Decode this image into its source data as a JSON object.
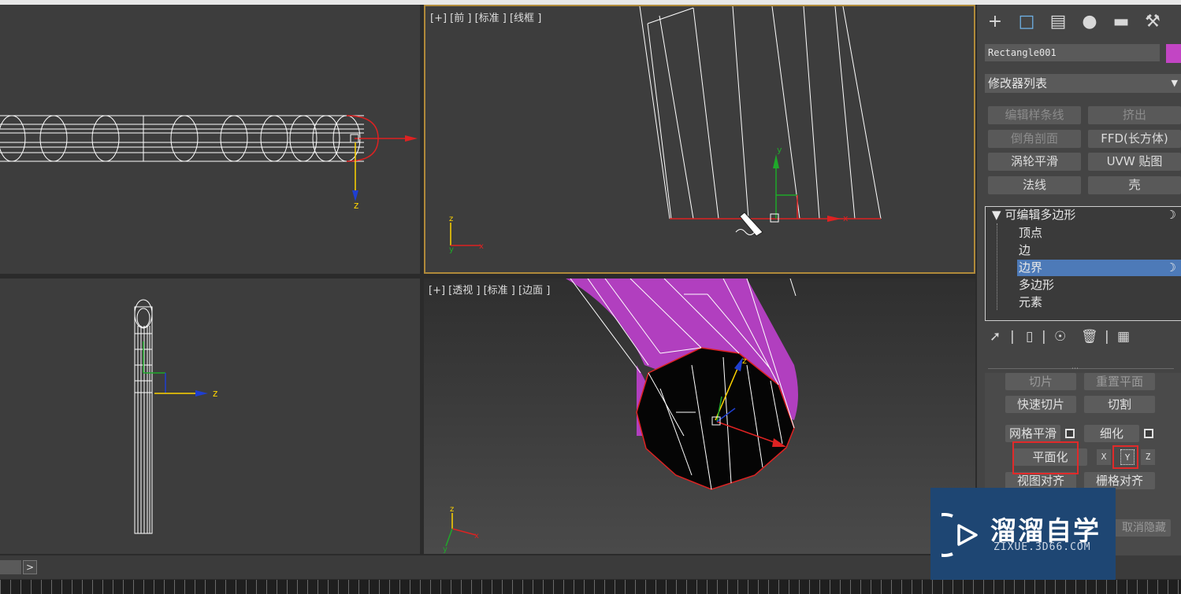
{
  "viewports": {
    "top_left": {
      "label": "",
      "axis_label": "z"
    },
    "front": {
      "label": "[+] [前 ] [标准 ] [线框 ]",
      "axis_y": "y",
      "axis_x": "x",
      "corner_z": "z",
      "corner_y": "y",
      "corner_x": "x"
    },
    "left": {
      "label": "",
      "axis_label": "z"
    },
    "perspective": {
      "label": "[+] [透视 ] [标准 ] [边面 ]",
      "axis_z": "z",
      "corner_z": "z",
      "corner_y": "y",
      "corner_x": "x"
    }
  },
  "panel": {
    "tabs": [
      "create-icon",
      "modify-icon",
      "hierarchy-icon",
      "motion-icon",
      "display-icon",
      "utilities-icon"
    ],
    "object_name": "Rectangle001",
    "object_color": "#c245c4",
    "modifier_list": "修改器列表",
    "modifier_buttons": [
      "编辑样条线",
      "挤出",
      "倒角剖面",
      "FFD(长方体)",
      "涡轮平滑",
      "UVW 贴图",
      "法线",
      "壳"
    ],
    "stack": {
      "root": "可编辑多边形",
      "items": [
        "顶点",
        "边",
        "边界",
        "多边形",
        "元素"
      ],
      "selected_index": 2
    },
    "rollout": {
      "row1": [
        "切片",
        "重置平面"
      ],
      "row2": [
        "快速切片",
        "切割"
      ],
      "row3": [
        "网格平滑",
        "细化"
      ],
      "make_planar": "平面化",
      "axes": [
        "X",
        "Y",
        "Z"
      ],
      "row5": [
        "视图对齐",
        "栅格对齐"
      ],
      "partial": "取消隐藏"
    }
  },
  "watermark": {
    "title": "溜溜自学",
    "subtitle": "ZIXUE.3D66.COM"
  },
  "status": {
    "arrow": ">"
  }
}
